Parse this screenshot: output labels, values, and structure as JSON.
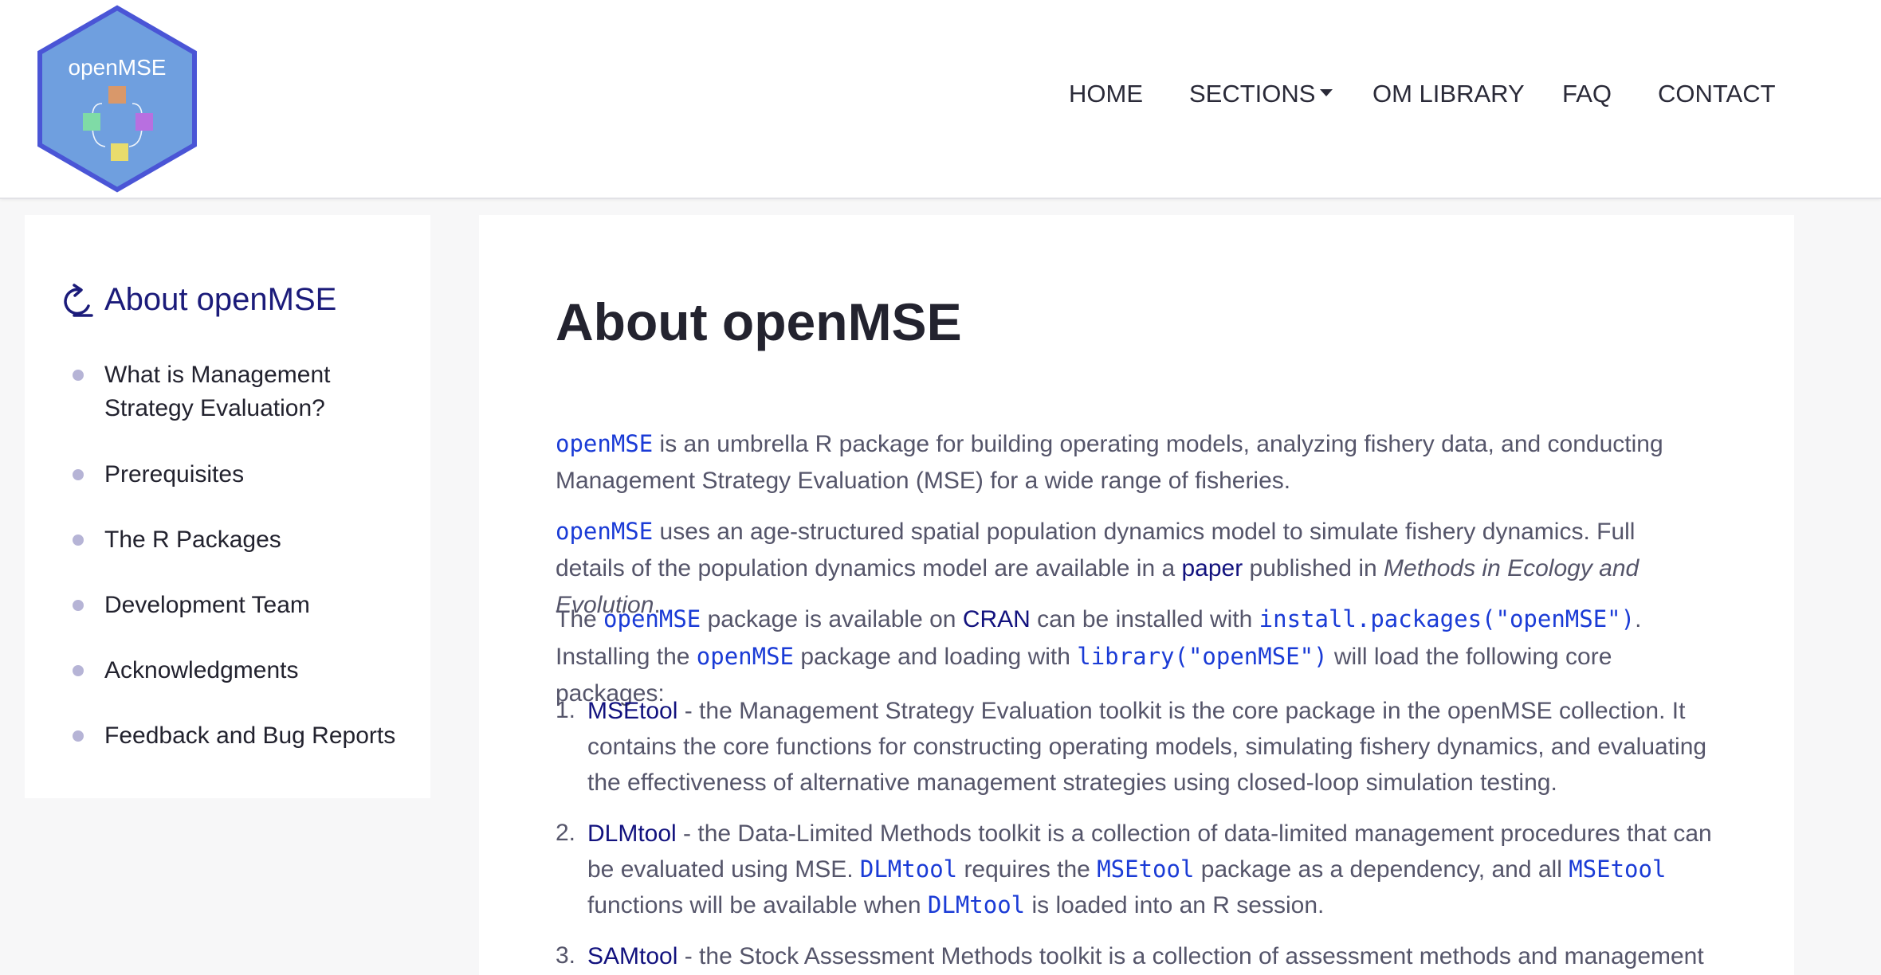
{
  "logo": {
    "text": "openMSE",
    "colors": {
      "fill": "#6f9fdf",
      "border": "#4a55d6",
      "square_top": "#d9986a",
      "square_left": "#7fdba6",
      "square_right": "#b86fe0",
      "square_bottom": "#e8dc6c"
    }
  },
  "nav": {
    "home": "HOME",
    "sections": "SECTIONS",
    "om_library": "OM LIBRARY",
    "faq": "FAQ",
    "contact": "CONTACT"
  },
  "sidebar": {
    "title": "About openMSE",
    "title_icon": "refresh-icon",
    "items": [
      "What is Management Strategy Evaluation?",
      "Prerequisites",
      "The R Packages",
      "Development Team",
      "Acknowledgments",
      "Feedback and Bug Reports"
    ]
  },
  "main": {
    "title": "About openMSE",
    "p1": {
      "code": "openMSE",
      "text": " is an umbrella R package for building operating models, analyzing fishery data, and conducting Management Strategy Evaluation (MSE) for a wide range of fisheries."
    },
    "p2": {
      "code": "openMSE",
      "text1": " uses an age-structured spatial population dynamics model to simulate fishery dynamics. Full details of the population dynamics model are available in a ",
      "link": "paper",
      "text2": " published in ",
      "em": "Methods in Ecology and Evolution",
      "text3": "."
    },
    "p3": {
      "text1": "The ",
      "code1": "openMSE",
      "text2": " package is available on ",
      "link": "CRAN",
      "text3": " can be installed with ",
      "code2": "install.packages(\"openMSE\")",
      "text4": ". Installing the ",
      "code3": "openMSE",
      "text5": " package and loading with ",
      "code4": "library(\"openMSE\")",
      "text6": " will load the following core packages:"
    },
    "list": [
      {
        "num": "1.",
        "link": "MSEtool",
        "text": " - the Management Strategy Evaluation toolkit is the core package in the openMSE collection. It contains the core functions for constructing operating models, simulating fishery dynamics, and evaluating the effectiveness of alternative management strategies using closed-loop simulation testing."
      },
      {
        "num": "2.",
        "link": "DLMtool",
        "text1": " - the Data-Limited Methods toolkit is a collection of data-limited management procedures that can be evaluated using MSE. ",
        "code1": "DLMtool",
        "text2": " requires the ",
        "code2": "MSEtool",
        "text3": " package as a dependency, and all ",
        "code3": "MSEtool",
        "text4": " functions will be available when ",
        "code4": "DLMtool",
        "text5": " is loaded into an R session."
      },
      {
        "num": "3.",
        "link": "SAMtool",
        "text": " - the Stock Assessment Methods toolkit is a collection of assessment methods and management"
      }
    ]
  }
}
